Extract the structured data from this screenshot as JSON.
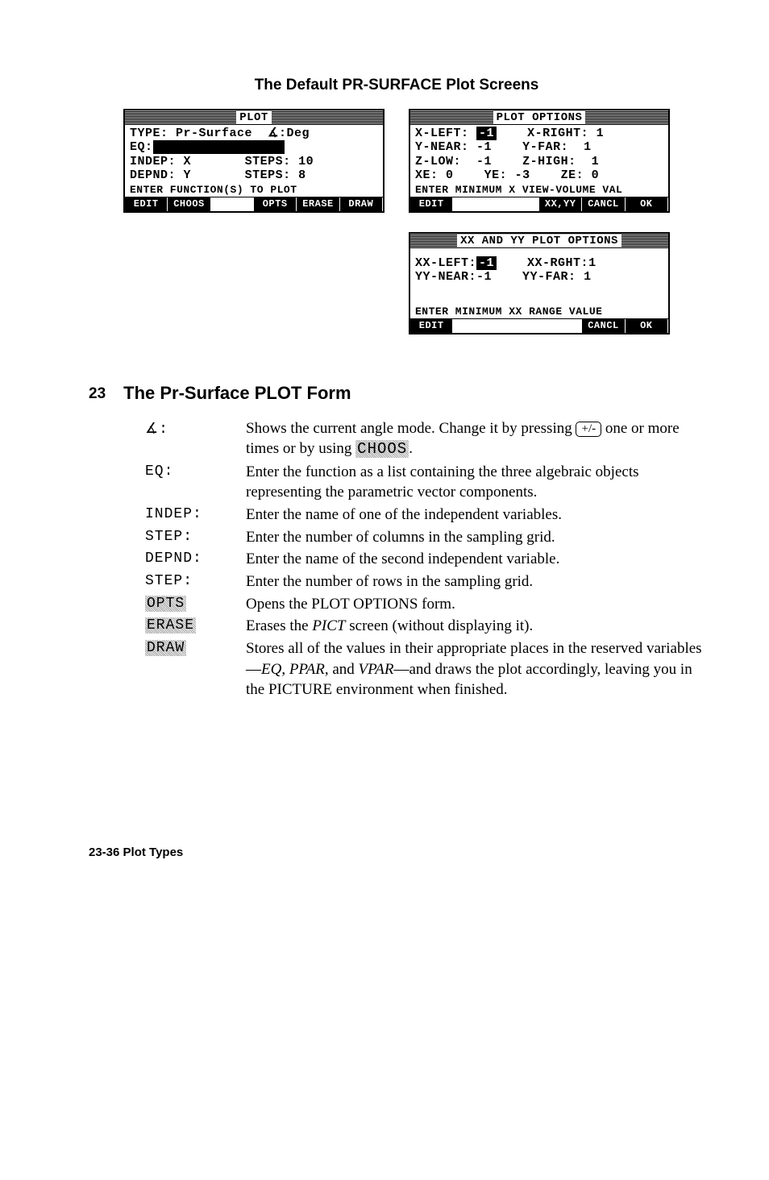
{
  "title": "The Default PR-SURFACE Plot Screens",
  "screens": {
    "plot": {
      "title": "PLOT",
      "type_label": "TYPE:",
      "type_value": "Pr-Surface",
      "angle_label": "∡:",
      "angle_value": "Deg",
      "eq_label": "EQ:",
      "eq_value": "",
      "indep_label": "INDEP:",
      "indep_value": "X",
      "indep_steps_label": "STEPS:",
      "indep_steps_value": "10",
      "depnd_label": "DEPND:",
      "depnd_value": "Y",
      "depnd_steps_label": "STEPS:",
      "depnd_steps_value": "8",
      "status": "ENTER FUNCTION(S) TO PLOT",
      "softkeys": [
        "EDIT",
        "CHOOS",
        "",
        "OPTS",
        "ERASE",
        "DRAW"
      ]
    },
    "options": {
      "title": "PLOT OPTIONS",
      "xleft_label": "X-LEFT:",
      "xleft_value": "-1",
      "xright_label": "X-RIGHT:",
      "xright_value": "1",
      "ynear_label": "Y-NEAR:",
      "ynear_value": "-1",
      "yfar_label": "Y-FAR:",
      "yfar_value": "1",
      "zlow_label": "Z-LOW:",
      "zlow_value": "-1",
      "zhigh_label": "Z-HIGH:",
      "zhigh_value": "1",
      "xe_label": "XE:",
      "xe_value": "0",
      "ye_label": "YE:",
      "ye_value": "-3",
      "ze_label": "ZE:",
      "ze_value": "0",
      "status": "ENTER MINIMUM X VIEW-VOLUME VAL",
      "softkeys": [
        "EDIT",
        "",
        "",
        "XX,YY",
        "CANCL",
        "OK"
      ]
    },
    "xxyy": {
      "title": "XX AND YY PLOT OPTIONS",
      "xxleft_label": "XX-LEFT:",
      "xxleft_value": "-1",
      "xxrght_label": "XX-RGHT:",
      "xxrght_value": "1",
      "yynear_label": "YY-NEAR:",
      "yynear_value": "-1",
      "yyfar_label": "YY-FAR:",
      "yyfar_value": "1",
      "status": "ENTER MINIMUM XX RANGE VALUE",
      "softkeys": [
        "EDIT",
        "",
        "",
        "",
        "CANCL",
        "OK"
      ]
    }
  },
  "section": {
    "num": "23",
    "title": "The Pr-Surface PLOT Form",
    "rows": {
      "angle": {
        "label": "∡:",
        "text_a": "Shows the current angle mode. Change it by pressing ",
        "key": "+/-",
        "text_b": " one or more times or by using ",
        "menu": "CHOOS",
        "text_c": "."
      },
      "eq": {
        "label": "EQ:",
        "text": "Enter the function as a list containing the three algebraic objects representing the parametric vector components."
      },
      "indep": {
        "label": "INDEP:",
        "text": "Enter the name of one of the independent variables."
      },
      "step1": {
        "label": "STEP:",
        "text": "Enter the number of columns in the sampling grid."
      },
      "depnd": {
        "label": "DEPND:",
        "text": "Enter the name of the second independent variable."
      },
      "step2": {
        "label": "STEP:",
        "text": "Enter the number of rows in the sampling grid."
      },
      "opts": {
        "label": "OPTS",
        "text": "Opens the PLOT OPTIONS form."
      },
      "erase": {
        "label": "ERASE",
        "text_a": "Erases the ",
        "var": "PICT",
        "text_b": " screen (without displaying it)."
      },
      "draw": {
        "label": "DRAW",
        "text_a": "Stores all of the values in their appropriate places in the reserved variables—",
        "var1": "EQ",
        "sep1": ", ",
        "var2": "PPAR",
        "sep2": ", and ",
        "var3": "VPAR",
        "text_b": "—and draws the plot accordingly, leaving you in the PICTURE environment when finished."
      }
    }
  },
  "footer": "23-36   Plot Types"
}
